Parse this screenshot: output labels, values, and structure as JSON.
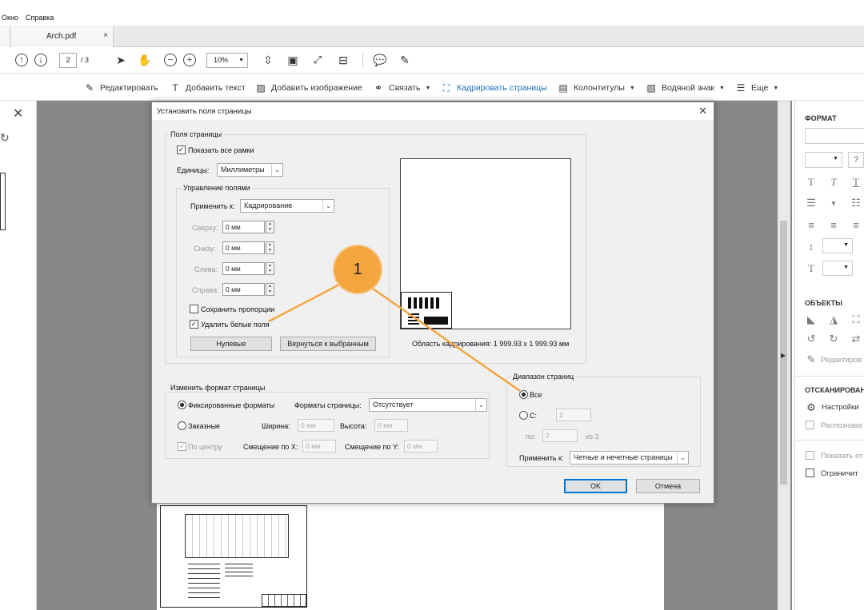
{
  "menu": {
    "okno": "Окно",
    "spravka": "Справка"
  },
  "tab": {
    "title": "Arch.pdf",
    "close": "×"
  },
  "toolbar": {
    "page_current": "2",
    "page_total": "/ 3",
    "zoom": "10%"
  },
  "edit_toolbar": {
    "edit": "Редактировать",
    "add_text": "Добавить текст",
    "add_image": "Добавить изображение",
    "link": "Связать",
    "crop": "Кадрировать страницы",
    "headers": "Колонтитулы",
    "watermark": "Водяной знак",
    "more": "Еще"
  },
  "dialog": {
    "title": "Установить поля страницы",
    "margins_group": "Поля страницы",
    "show_all_frames": "Показать все рамки",
    "units_label": "Единицы:",
    "units_value": "Миллиметры",
    "margin_control": "Управление полями",
    "apply_to_label": "Применить к:",
    "apply_to_value": "Кадрирование",
    "top": "Сверху:",
    "bottom": "Снизу:",
    "left": "Слева:",
    "right": "Справа:",
    "top_val": "0 мм",
    "bottom_val": "0 мм",
    "left_val": "0 мм",
    "right_val": "0 мм",
    "keep_proportions": "Сохранить пропорции",
    "remove_white": "Удалить белые поля",
    "zero_button": "Нулевые",
    "revert_button": "Вернуться к выбранным",
    "crop_area": "Область кадрирования: 1 999.93 x 1 999.93 мм",
    "change_format_group": "Изменить формат страницы",
    "fixed_formats": "Фиксированные форматы",
    "page_formats_label": "Форматы страницы:",
    "page_formats_value": "Отсутствует",
    "custom": "Заказные",
    "width_label": "Ширина:",
    "width_val": "0 мм",
    "height_label": "Высота:",
    "height_val": "0 мм",
    "center": "По центру",
    "offset_x_label": "Смещение по X:",
    "offset_x_val": "0 мм",
    "offset_y_label": "Смещение по Y:",
    "offset_y_val": "0 мм",
    "range_group": "Диапазон страниц",
    "all": "Все",
    "from": "С:",
    "from_val": "2",
    "to": "по:",
    "to_val": "2",
    "of": "из 3",
    "apply_range_label": "Применить к:",
    "apply_range_value": "Четные и нечетные страницы",
    "ok": "OK",
    "cancel": "Отмена"
  },
  "callout": "1",
  "right_panel": {
    "format": "ФОРМАТ",
    "objects": "ОБЪЕКТЫ",
    "edit": "Редактиров",
    "scanned": "ОТСКАНИРОВАН",
    "settings": "Настройки",
    "recognize": "Распознава",
    "show": "Показать от",
    "limit": "Ограничит"
  },
  "colors": {
    "accent": "#1a6ec0",
    "callout": "#f3a540",
    "workspace": "#888888"
  }
}
